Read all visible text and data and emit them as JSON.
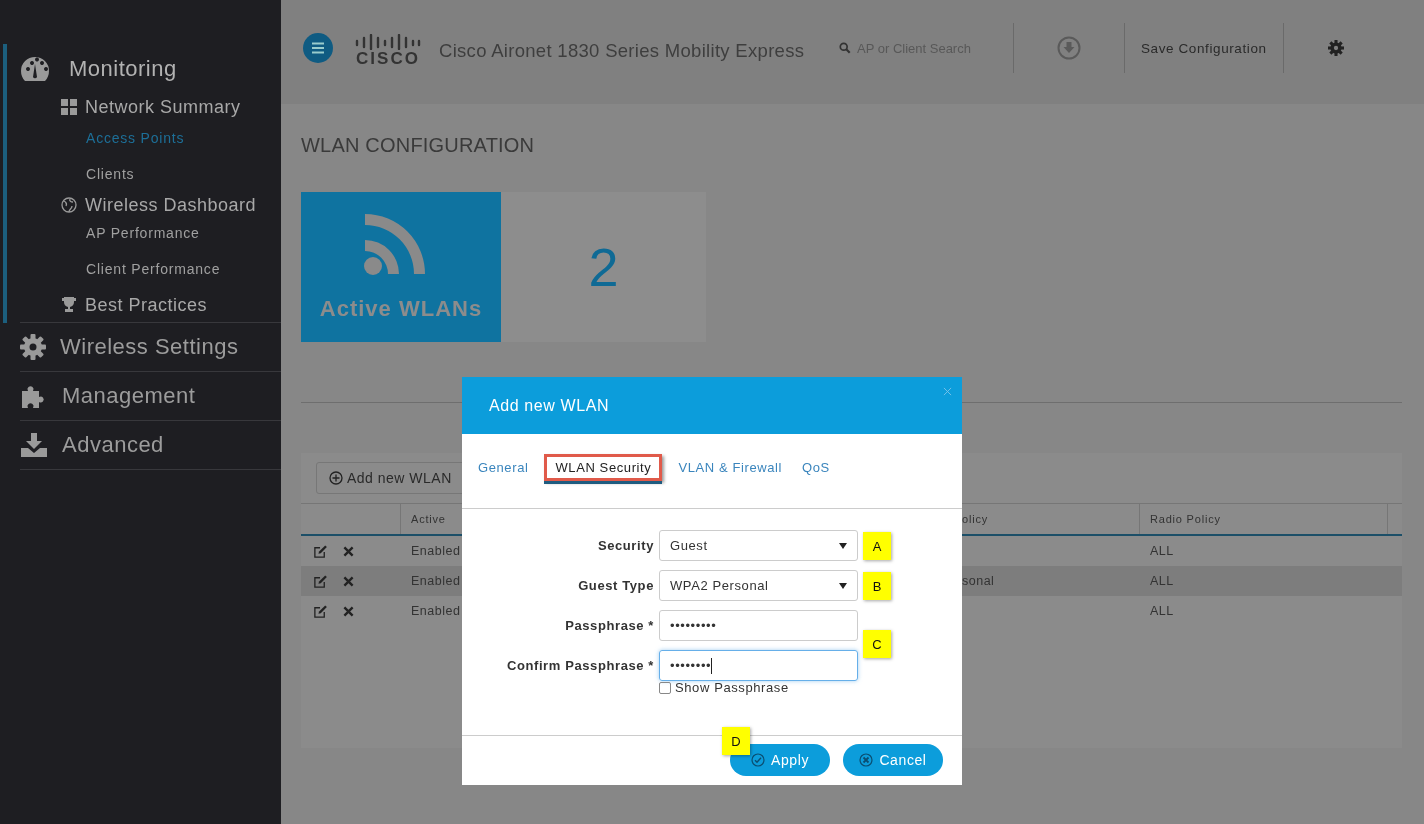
{
  "sidebar": {
    "sections": [
      {
        "label": "Monitoring",
        "selected": true,
        "children": [
          {
            "label": "Network Summary",
            "children": [
              {
                "label": "Access Points",
                "selected": true
              },
              {
                "label": "Clients",
                "selected": false
              }
            ]
          },
          {
            "label": "Wireless Dashboard",
            "children": [
              {
                "label": "AP Performance",
                "selected": false
              },
              {
                "label": "Client Performance",
                "selected": false
              }
            ]
          },
          {
            "label": "Best Practices"
          }
        ]
      },
      {
        "label": "Wireless Settings",
        "selected": false
      },
      {
        "label": "Management",
        "selected": false
      },
      {
        "label": "Advanced",
        "selected": false
      }
    ]
  },
  "header": {
    "logo": "CISCO",
    "title": "Cisco Aironet 1830 Series Mobility Express",
    "search": {
      "placeholder": "AP or Client Search"
    },
    "save_button": "Save Configuration"
  },
  "page_title": "WLAN CONFIGURATION",
  "tile": {
    "label": "Active WLANs",
    "count": "2"
  },
  "table": {
    "add_button": "Add new WLAN",
    "columns": [
      "Active",
      "olicy",
      "Radio Policy"
    ],
    "rows": [
      {
        "selected": false,
        "active": "Enabled",
        "radio_policy": "ALL"
      },
      {
        "selected": true,
        "active": "Enabled",
        "column_3": "sonal",
        "radio_policy": "ALL"
      },
      {
        "selected": false,
        "active": "Enabled",
        "radio_policy": "ALL"
      }
    ]
  },
  "dialog": {
    "title": "Add new WLAN",
    "tabs": [
      {
        "label": "General",
        "selected": false
      },
      {
        "label": "WLAN Security",
        "selected": true
      },
      {
        "label": "VLAN & Firewall",
        "selected": false
      },
      {
        "label": "QoS",
        "selected": false
      }
    ],
    "fields": [
      {
        "kind": "select",
        "label": "Security",
        "value": "Guest",
        "focused": false
      },
      {
        "kind": "select",
        "label": "Guest Type",
        "value": "WPA2 Personal",
        "focused": false
      },
      {
        "kind": "text",
        "label": "Passphrase *",
        "value": "•••••••••",
        "focused": false
      },
      {
        "kind": "text",
        "label": "Confirm Passphrase *",
        "value": "••••••••",
        "focused": true
      }
    ],
    "show_passphrase": {
      "label": "Show Passphrase",
      "checked": false
    },
    "buttons": [
      {
        "kind": "apply",
        "label": "Apply"
      },
      {
        "kind": "cancel",
        "label": "Cancel"
      }
    ],
    "callouts": [
      "A",
      "B",
      "C",
      "D"
    ]
  }
}
